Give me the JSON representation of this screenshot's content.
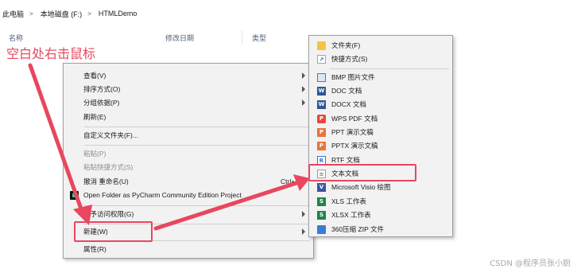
{
  "breadcrumb": [
    "此电脑",
    "本地磁盘 (F:)",
    "HTMLDemo"
  ],
  "columns": [
    "名称",
    "修改日期",
    "类型"
  ],
  "annotation": "空白处右击鼠标",
  "context_menu": {
    "items": [
      {
        "label": "查看(V)",
        "submenu": true
      },
      {
        "label": "排序方式(O)",
        "submenu": true
      },
      {
        "label": "分组依据(P)",
        "submenu": true
      },
      {
        "label": "刷新(E)"
      },
      {
        "label": "自定义文件夹(F)..."
      },
      {
        "label": "粘贴(P)",
        "disabled": true
      },
      {
        "label": "粘贴快捷方式(S)",
        "disabled": true
      },
      {
        "label": "撤消 重命名(U)",
        "shortcut": "Ctrl+Z"
      },
      {
        "label": "Open Folder as PyCharm Community Edition Project",
        "icon": "pycharm-icon"
      },
      {
        "label": "授予访问权限(G)",
        "submenu": true
      },
      {
        "label": "新建(W)",
        "submenu": true
      },
      {
        "label": "属性(R)"
      }
    ]
  },
  "new_submenu": {
    "items": [
      {
        "label": "文件夹(F)",
        "icon": "folder-icon",
        "color": "#f5c542"
      },
      {
        "label": "快捷方式(S)",
        "icon": "shortcut-icon",
        "color": "#2b5797"
      },
      {
        "label": "BMP 图片文件",
        "icon": "bmp-icon",
        "color": "#4a78c9"
      },
      {
        "label": "DOC 文档",
        "icon": "word-icon",
        "color": "#2b579a"
      },
      {
        "label": "DOCX 文档",
        "icon": "word-icon",
        "color": "#2b579a"
      },
      {
        "label": "WPS PDF 文档",
        "icon": "wps-pdf-icon",
        "color": "#e8473c"
      },
      {
        "label": "PPT 演示文稿",
        "icon": "ppt-icon",
        "color": "#e8743b"
      },
      {
        "label": "PPTX 演示文稿",
        "icon": "ppt-icon",
        "color": "#e8743b"
      },
      {
        "label": "RTF 文档",
        "icon": "rtf-icon",
        "color": "#3c6fd1"
      },
      {
        "label": "文本文档",
        "icon": "text-document-icon",
        "color": "#ffffff"
      },
      {
        "label": "Microsoft Visio 绘图",
        "icon": "visio-icon",
        "color": "#3955a3"
      },
      {
        "label": "XLS 工作表",
        "icon": "excel-icon",
        "color": "#1e8449"
      },
      {
        "label": "XLSX 工作表",
        "icon": "excel-icon",
        "color": "#1e8449"
      },
      {
        "label": "360压缩 ZIP 文件",
        "icon": "zip-icon",
        "color": "#3a7bd5"
      }
    ]
  },
  "watermark": "CSDN @程序员张小厨",
  "accent_color": "#e8475f"
}
